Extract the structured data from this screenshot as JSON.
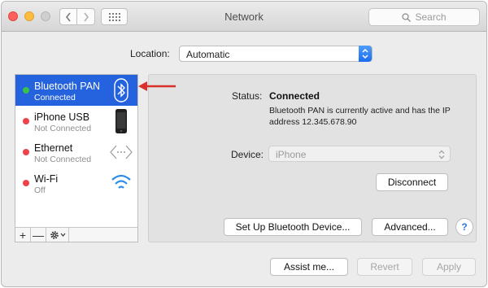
{
  "window": {
    "title": "Network",
    "search_placeholder": "Search"
  },
  "location": {
    "label": "Location:",
    "value": "Automatic"
  },
  "services": [
    {
      "name": "Bluetooth PAN",
      "status": "Connected",
      "state_color": "#39c24a",
      "icon": "bluetooth-icon",
      "selected": true
    },
    {
      "name": "iPhone USB",
      "status": "Not Connected",
      "state_color": "#ef4248",
      "icon": "iphone-icon",
      "selected": false
    },
    {
      "name": "Ethernet",
      "status": "Not Connected",
      "state_color": "#ef4248",
      "icon": "ethernet-icon",
      "selected": false
    },
    {
      "name": "Wi-Fi",
      "status": "Off",
      "state_color": "#ef4248",
      "icon": "wifi-icon",
      "selected": false
    }
  ],
  "sidebar_tools": {
    "add": "+",
    "remove": "—"
  },
  "detail": {
    "status_label": "Status:",
    "status_value": "Connected",
    "status_description": "Bluetooth PAN is currently active and has the IP address 12.345.678.90",
    "device_label": "Device:",
    "device_value": "iPhone",
    "disconnect_label": "Disconnect",
    "setup_label": "Set Up Bluetooth Device...",
    "advanced_label": "Advanced...",
    "help_label": "?"
  },
  "footer": {
    "assist_label": "Assist me...",
    "revert_label": "Revert",
    "apply_label": "Apply"
  },
  "colors": {
    "selection": "#2463dd",
    "connected": "#39c24a",
    "disconnected": "#ef4248",
    "accent": "#1b6cf1",
    "annotation_arrow": "#d9302c"
  }
}
